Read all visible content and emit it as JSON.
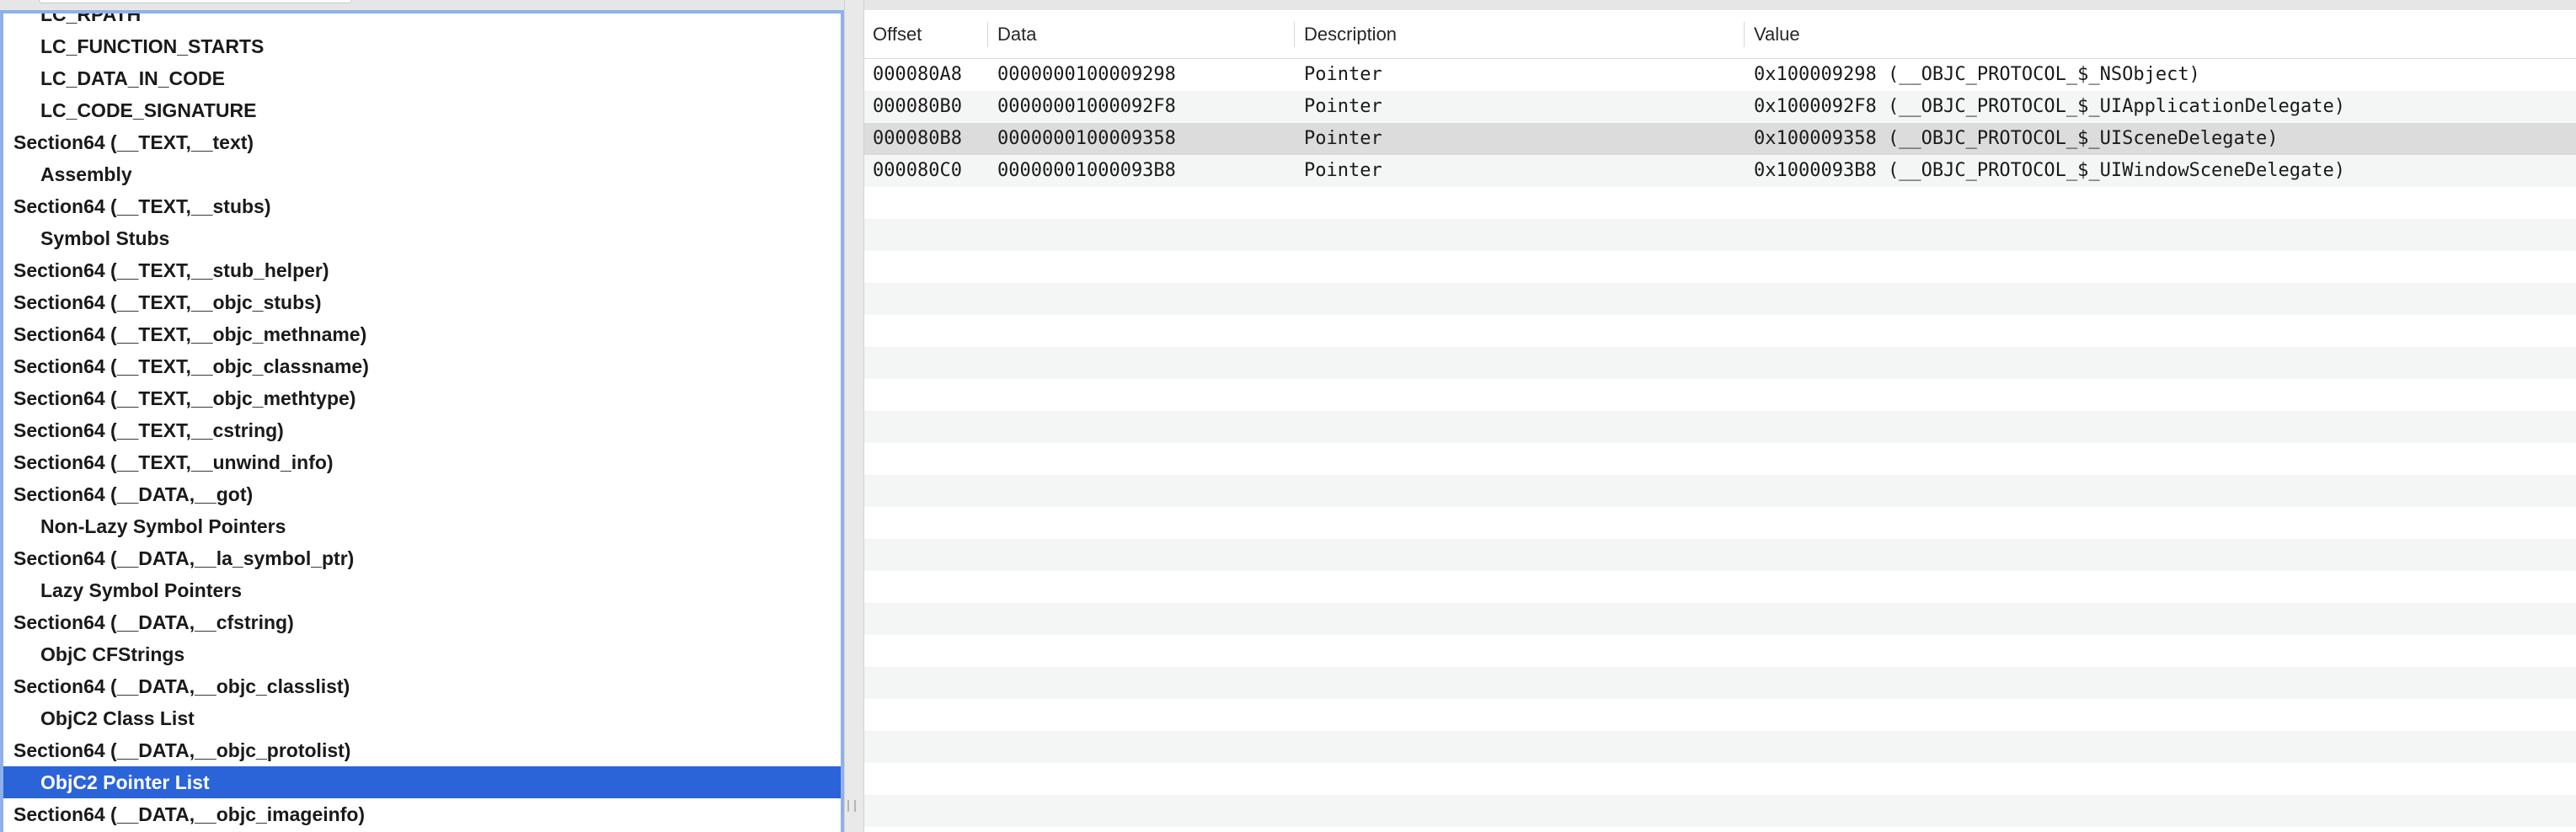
{
  "tree": {
    "items": [
      {
        "label": "LC_RPATH",
        "level": 1,
        "selected": false
      },
      {
        "label": "LC_FUNCTION_STARTS",
        "level": 1,
        "selected": false
      },
      {
        "label": "LC_DATA_IN_CODE",
        "level": 1,
        "selected": false
      },
      {
        "label": "LC_CODE_SIGNATURE",
        "level": 1,
        "selected": false
      },
      {
        "label": "Section64 (__TEXT,__text)",
        "level": 0,
        "selected": false
      },
      {
        "label": "Assembly",
        "level": 1,
        "selected": false
      },
      {
        "label": "Section64 (__TEXT,__stubs)",
        "level": 0,
        "selected": false
      },
      {
        "label": "Symbol Stubs",
        "level": 1,
        "selected": false
      },
      {
        "label": "Section64 (__TEXT,__stub_helper)",
        "level": 0,
        "selected": false
      },
      {
        "label": "Section64 (__TEXT,__objc_stubs)",
        "level": 0,
        "selected": false
      },
      {
        "label": "Section64 (__TEXT,__objc_methname)",
        "level": 0,
        "selected": false
      },
      {
        "label": "Section64 (__TEXT,__objc_classname)",
        "level": 0,
        "selected": false
      },
      {
        "label": "Section64 (__TEXT,__objc_methtype)",
        "level": 0,
        "selected": false
      },
      {
        "label": "Section64 (__TEXT,__cstring)",
        "level": 0,
        "selected": false
      },
      {
        "label": "Section64 (__TEXT,__unwind_info)",
        "level": 0,
        "selected": false
      },
      {
        "label": "Section64 (__DATA,__got)",
        "level": 0,
        "selected": false
      },
      {
        "label": "Non-Lazy Symbol Pointers",
        "level": 1,
        "selected": false
      },
      {
        "label": "Section64 (__DATA,__la_symbol_ptr)",
        "level": 0,
        "selected": false
      },
      {
        "label": "Lazy Symbol Pointers",
        "level": 1,
        "selected": false
      },
      {
        "label": "Section64 (__DATA,__cfstring)",
        "level": 0,
        "selected": false
      },
      {
        "label": "ObjC CFStrings",
        "level": 1,
        "selected": false
      },
      {
        "label": "Section64 (__DATA,__objc_classlist)",
        "level": 0,
        "selected": false
      },
      {
        "label": "ObjC2 Class List",
        "level": 1,
        "selected": false
      },
      {
        "label": "Section64 (__DATA,__objc_protolist)",
        "level": 0,
        "selected": false
      },
      {
        "label": "ObjC2 Pointer List",
        "level": 1,
        "selected": true
      },
      {
        "label": "Section64 (__DATA,__objc_imageinfo)",
        "level": 0,
        "selected": false
      }
    ]
  },
  "table": {
    "columns": [
      "Offset",
      "Data",
      "Description",
      "Value"
    ],
    "rows": [
      {
        "offset": "000080A8",
        "data": "0000000100009298",
        "description": "Pointer",
        "value": "0x100009298 (__OBJC_PROTOCOL_$_NSObject)",
        "highlighted": false
      },
      {
        "offset": "000080B0",
        "data": "00000001000092F8",
        "description": "Pointer",
        "value": "0x1000092F8 (__OBJC_PROTOCOL_$_UIApplicationDelegate)",
        "highlighted": false
      },
      {
        "offset": "000080B8",
        "data": "0000000100009358",
        "description": "Pointer",
        "value": "0x100009358 (__OBJC_PROTOCOL_$_UISceneDelegate)",
        "highlighted": true
      },
      {
        "offset": "000080C0",
        "data": "00000001000093B8",
        "description": "Pointer",
        "value": "0x1000093B8 (__OBJC_PROTOCOL_$_UIWindowSceneDelegate)",
        "highlighted": false
      }
    ]
  },
  "colors": {
    "selection": "#2b63d9",
    "focus_ring": "#8fb0ea",
    "row_alt": "#f4f5f5",
    "row_highlight": "#dcdcdc"
  }
}
